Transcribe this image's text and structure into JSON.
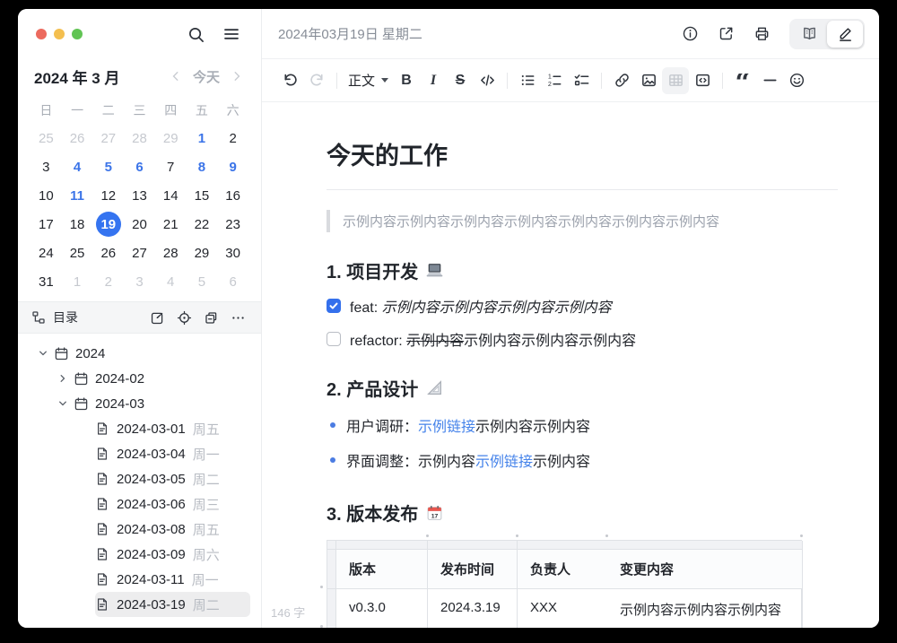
{
  "colors": {
    "accent": "#3470ec",
    "link": "#4583ea",
    "selected_day": "#3574f0"
  },
  "sidebar": {
    "month_title": "2024 年 3 月",
    "today_label": "今天",
    "calendar": {
      "weekdays": [
        "日",
        "一",
        "二",
        "三",
        "四",
        "五",
        "六"
      ],
      "days": [
        {
          "d": "25",
          "s": "dim"
        },
        {
          "d": "26",
          "s": "dim"
        },
        {
          "d": "27",
          "s": "dim"
        },
        {
          "d": "28",
          "s": "dim"
        },
        {
          "d": "29",
          "s": "dim"
        },
        {
          "d": "1",
          "s": "blue"
        },
        {
          "d": "2",
          "s": "norm"
        },
        {
          "d": "3",
          "s": "norm"
        },
        {
          "d": "4",
          "s": "blue"
        },
        {
          "d": "5",
          "s": "blue"
        },
        {
          "d": "6",
          "s": "blue"
        },
        {
          "d": "7",
          "s": "norm"
        },
        {
          "d": "8",
          "s": "blue"
        },
        {
          "d": "9",
          "s": "blue"
        },
        {
          "d": "10",
          "s": "norm"
        },
        {
          "d": "11",
          "s": "blue"
        },
        {
          "d": "12",
          "s": "norm"
        },
        {
          "d": "13",
          "s": "norm"
        },
        {
          "d": "14",
          "s": "norm"
        },
        {
          "d": "15",
          "s": "norm"
        },
        {
          "d": "16",
          "s": "norm"
        },
        {
          "d": "17",
          "s": "norm"
        },
        {
          "d": "18",
          "s": "norm"
        },
        {
          "d": "19",
          "s": "sel"
        },
        {
          "d": "20",
          "s": "norm"
        },
        {
          "d": "21",
          "s": "norm"
        },
        {
          "d": "22",
          "s": "norm"
        },
        {
          "d": "23",
          "s": "norm"
        },
        {
          "d": "24",
          "s": "norm"
        },
        {
          "d": "25",
          "s": "norm"
        },
        {
          "d": "26",
          "s": "norm"
        },
        {
          "d": "27",
          "s": "norm"
        },
        {
          "d": "28",
          "s": "norm"
        },
        {
          "d": "29",
          "s": "norm"
        },
        {
          "d": "30",
          "s": "norm"
        },
        {
          "d": "31",
          "s": "norm"
        },
        {
          "d": "1",
          "s": "dim"
        },
        {
          "d": "2",
          "s": "dim"
        },
        {
          "d": "3",
          "s": "dim"
        },
        {
          "d": "4",
          "s": "dim"
        },
        {
          "d": "5",
          "s": "dim"
        },
        {
          "d": "6",
          "s": "dim"
        }
      ]
    },
    "toc_title": "目录",
    "tree": [
      {
        "label": "2024",
        "expander": "down",
        "icon": "calendar",
        "level": 0
      },
      {
        "label": "2024-02",
        "expander": "right",
        "icon": "calendar",
        "level": 1
      },
      {
        "label": "2024-03",
        "expander": "down",
        "icon": "calendar",
        "level": 1
      },
      {
        "label": "2024-03-01",
        "week": "周五",
        "icon": "document",
        "level": 2
      },
      {
        "label": "2024-03-04",
        "week": "周一",
        "icon": "document",
        "level": 2
      },
      {
        "label": "2024-03-05",
        "week": "周二",
        "icon": "document",
        "level": 2
      },
      {
        "label": "2024-03-06",
        "week": "周三",
        "icon": "document",
        "level": 2
      },
      {
        "label": "2024-03-08",
        "week": "周五",
        "icon": "document",
        "level": 2
      },
      {
        "label": "2024-03-09",
        "week": "周六",
        "icon": "document",
        "level": 2
      },
      {
        "label": "2024-03-11",
        "week": "周一",
        "icon": "document",
        "level": 2
      },
      {
        "label": "2024-03-19",
        "week": "周二",
        "icon": "document",
        "level": 2,
        "selected": true
      }
    ]
  },
  "header": {
    "date_title": "2024年03月19日 星期二"
  },
  "toolbar": {
    "paragraph_style": "正文",
    "bold_label": "B",
    "italic_label": "I",
    "strike_label": "S"
  },
  "content": {
    "title": "今天的工作",
    "quote": "示例内容示例内容示例内容示例内容示例内容示例内容示例内容",
    "section1": {
      "heading": "1. 项目开发",
      "emoji": "laptop"
    },
    "todo1": {
      "checked": true,
      "prefix": "feat: ",
      "italic": "示例内容示例内容示例内容示例内容"
    },
    "todo2": {
      "checked": false,
      "prefix": "refactor: ",
      "strike": "示例内容",
      "rest": "示例内容示例内容示例内容"
    },
    "section2": {
      "heading": "2. 产品设计",
      "emoji": "triangular-ruler"
    },
    "bullet1": {
      "before": "用户调研：",
      "link": "示例链接",
      "after": "示例内容示例内容"
    },
    "bullet2": {
      "before": "界面调整：示例内容",
      "link": "示例链接",
      "after": "示例内容"
    },
    "section3": {
      "heading": "3. 版本发布",
      "emoji": "calendar",
      "calendar_emoji_day": "17"
    },
    "table": {
      "headers": [
        "版本",
        "发布时间",
        "负责人",
        "变更内容"
      ],
      "rows": [
        [
          "v0.3.0",
          "2024.3.19",
          "XXX",
          "示例内容示例内容示例内容"
        ]
      ]
    },
    "word_count": "146 字"
  }
}
